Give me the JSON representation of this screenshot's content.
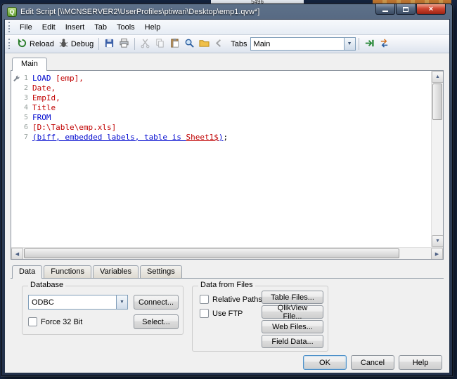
{
  "desktop": {
    "artifact": "5496"
  },
  "window": {
    "title": "Edit Script [\\\\MCNSERVER2\\UserProfiles\\ptiwari\\Desktop\\emp1.qvw*]",
    "close_glyph": "×",
    "app_initial": "Q"
  },
  "menu": {
    "items": [
      "File",
      "Edit",
      "Insert",
      "Tab",
      "Tools",
      "Help"
    ]
  },
  "toolbar": {
    "reload_label": "Reload",
    "debug_label": "Debug",
    "tabs_label": "Tabs",
    "tab_combo_value": "Main"
  },
  "sheet_tabs": {
    "items": [
      "Main"
    ],
    "active": "Main"
  },
  "editor": {
    "lines": [
      {
        "num": "1",
        "segments": [
          {
            "t": "LOAD ",
            "s": "kw"
          },
          {
            "t": "[emp],",
            "s": "fld"
          }
        ]
      },
      {
        "num": "2",
        "segments": [
          {
            "t": "Date,",
            "s": "fld"
          }
        ]
      },
      {
        "num": "3",
        "segments": [
          {
            "t": "EmpId,",
            "s": "fld"
          }
        ]
      },
      {
        "num": "4",
        "segments": [
          {
            "t": "Title",
            "s": "fld"
          }
        ]
      },
      {
        "num": "5",
        "segments": [
          {
            "t": "FROM",
            "s": "kw"
          }
        ]
      },
      {
        "num": "6",
        "segments": [
          {
            "t": "[D:\\Table\\emp.xls]",
            "s": "fld"
          }
        ]
      },
      {
        "num": "7",
        "segments": [
          {
            "t": "(biff, embedded labels, table is ",
            "s": "fmt"
          },
          {
            "t": "Sheet1$",
            "s": "fmtfld"
          },
          {
            "t": ")",
            "s": "fmt"
          },
          {
            "t": ";",
            "s": "plain"
          }
        ]
      }
    ]
  },
  "panel_tabs": {
    "items": [
      "Data",
      "Functions",
      "Variables",
      "Settings"
    ],
    "active": "Data"
  },
  "database_group": {
    "legend": "Database",
    "combo_value": "ODBC",
    "connect_label": "Connect...",
    "force32_label": "Force 32 Bit",
    "select_label": "Select..."
  },
  "files_group": {
    "legend": "Data from Files",
    "relative_paths_label": "Relative Paths",
    "use_ftp_label": "Use FTP",
    "buttons": [
      "Table Files...",
      "QlikView File...",
      "Web Files...",
      "Field Data..."
    ]
  },
  "footer": {
    "ok": "OK",
    "cancel": "Cancel",
    "help": "Help"
  },
  "icons": {
    "combo_arrow": "▼",
    "scroll_up": "▲",
    "scroll_down": "▼",
    "scroll_left": "◀",
    "scroll_right": "▶"
  }
}
